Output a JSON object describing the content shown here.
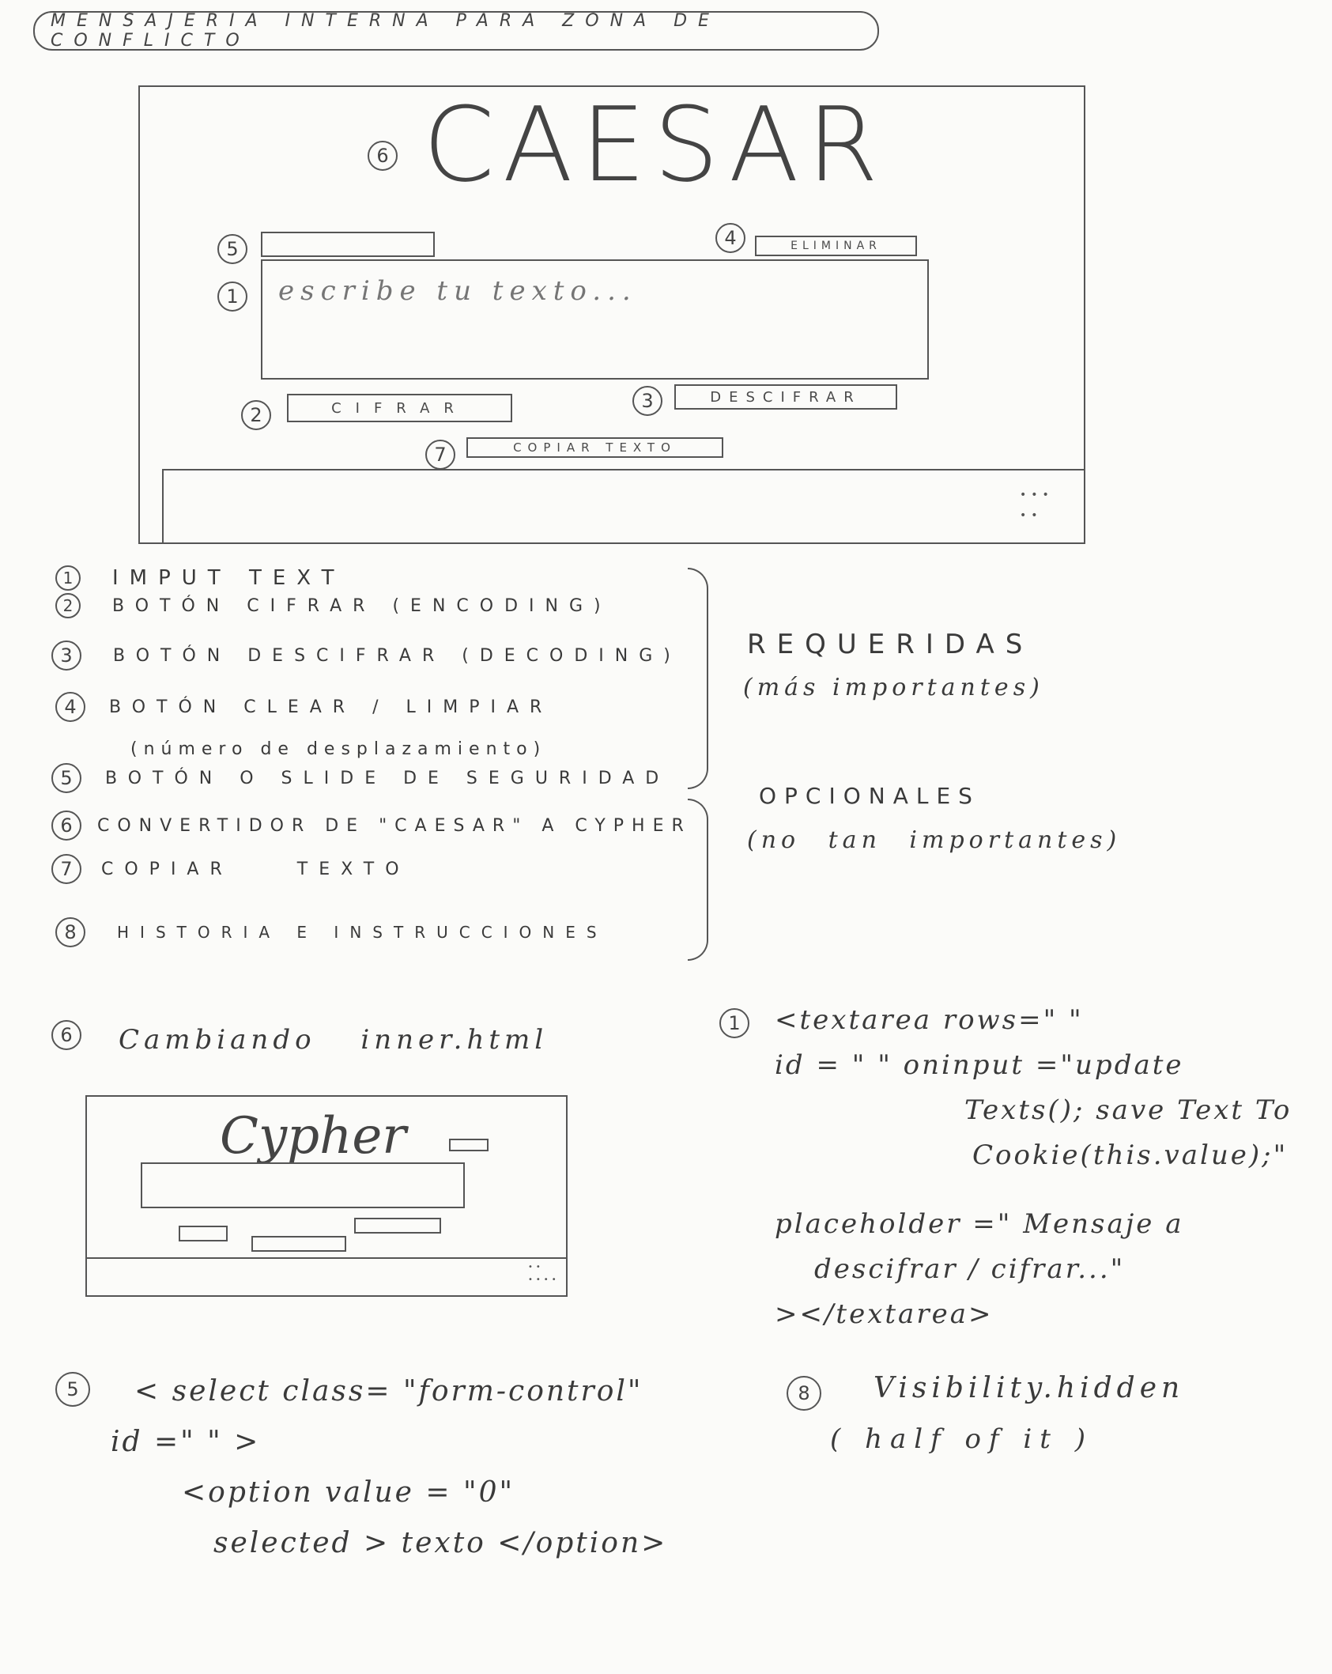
{
  "header": {
    "title": "MENSAJERIA INTERNA PARA ZONA DE CONFLICTO"
  },
  "mockup": {
    "title": "CAESAR",
    "textarea_placeholder": "escribe tu texto...",
    "delete_label": "ELIMINAR",
    "encode_label": "CIFRAR",
    "decode_label": "DESCIFRAR",
    "copy_label": "COPIAR TEXTO",
    "markers": {
      "m1": "1",
      "m2": "2",
      "m3": "3",
      "m4": "4",
      "m5": "5",
      "m6": "6",
      "m7": "7"
    }
  },
  "features": {
    "items": [
      {
        "num": "1",
        "label": "IMPUT TEXT"
      },
      {
        "num": "2",
        "label": "BOTÓN CIFRAR (ENCODING)"
      },
      {
        "num": "3",
        "label": "BOTÓN DESCIFRAR (DECODING)"
      },
      {
        "num": "4",
        "label": "BOTÓN CLEAR / LIMPIAR"
      },
      {
        "num": "5",
        "label": "BOTÓN O SLIDE DE SEGURIDAD",
        "note": "(número de desplazamiento)"
      },
      {
        "num": "6",
        "label": "CONVERTIDOR DE \"CAESAR\" A CYPHER"
      },
      {
        "num": "7",
        "label": "COPIAR TEXTO"
      },
      {
        "num": "8",
        "label": "HISTORIA E INSTRUCCIONES"
      }
    ],
    "required_title": "REQUERIDAS",
    "required_note": "(más importantes)",
    "optional_title": "OPCIONALES",
    "optional_note": "(no tan importantes)"
  },
  "notes": {
    "n6_num": "6",
    "n6_text": "Cambiando inner.html",
    "cypher_title": "Cypher",
    "n1_num": "1",
    "n1_code": [
      "<textarea rows=\" \"",
      "id = \" \"   oninput =\"update",
      "Texts(); save Text To",
      "Cookie(this.value);\"",
      "placeholder =\" Mensaje a",
      "descifrar / cifrar...\"",
      "></textarea>"
    ],
    "n5_num": "5",
    "n5_code": [
      "< select  class= \"form-control\"",
      "id =\" \" >",
      "<option value = \"0\"",
      "selected > texto </option>"
    ],
    "n8_num": "8",
    "n8_text": "Visibility.hidden",
    "n8_note": "( half of it )"
  }
}
